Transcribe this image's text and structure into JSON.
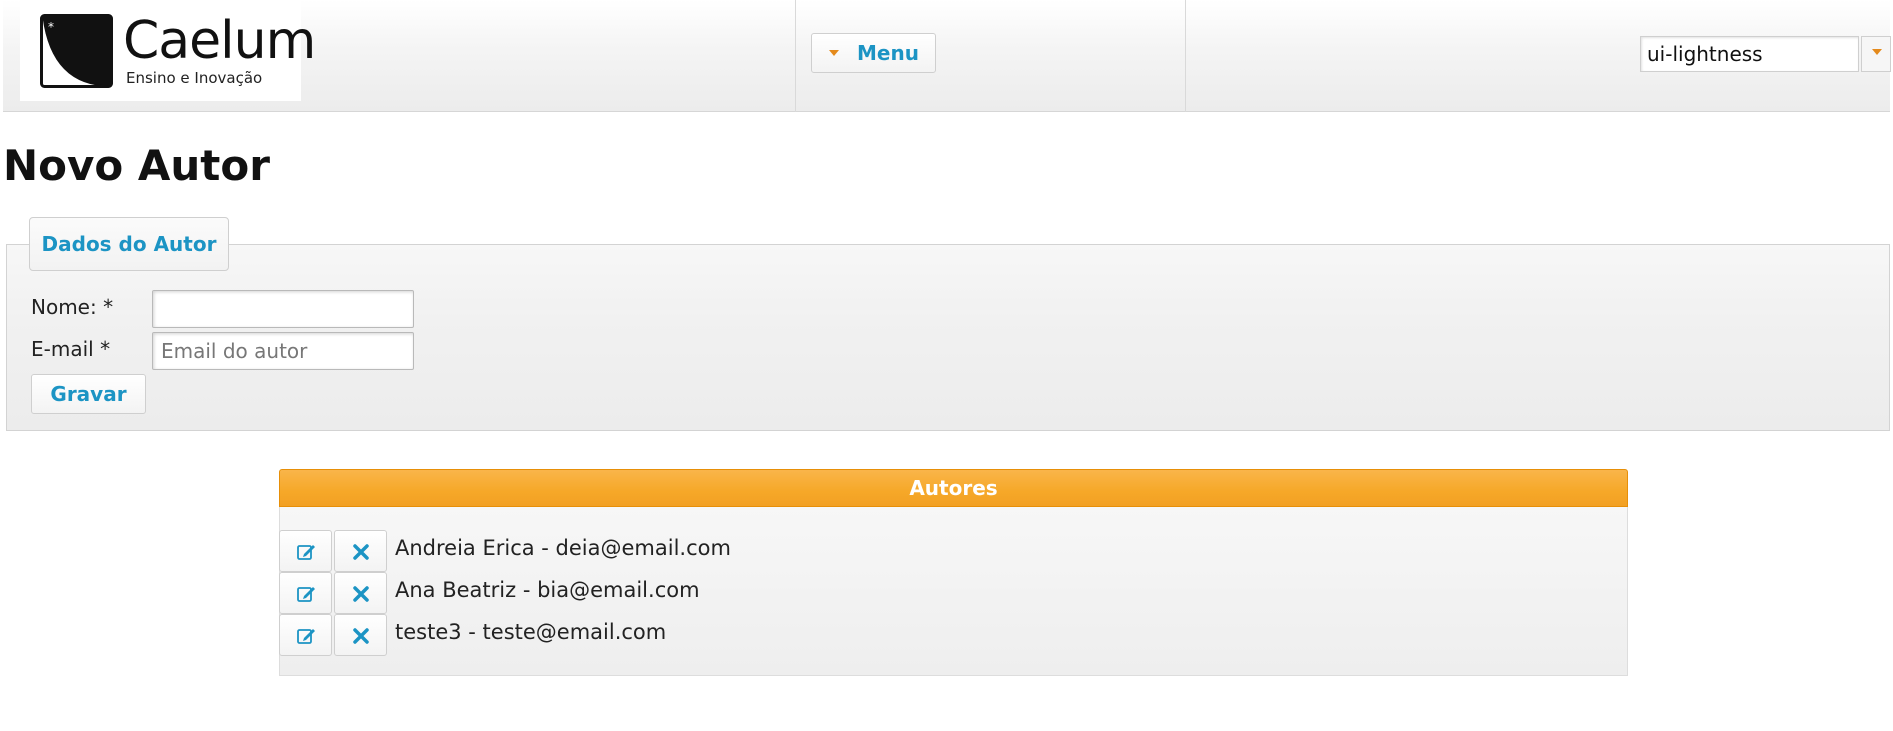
{
  "header": {
    "logo": {
      "brand": "Caelum",
      "tagline": "Ensino e Inovação"
    },
    "menu_label": "Menu",
    "theme_value": "ui-lightness"
  },
  "page": {
    "title": "Novo Autor"
  },
  "form": {
    "legend": "Dados do Autor",
    "name_label": "Nome: *",
    "name_value": "",
    "email_label": "E-mail *",
    "email_placeholder": "Email do autor",
    "save_label": "Gravar"
  },
  "autores": {
    "header": "Autores",
    "rows": [
      {
        "text": "Andreia Erica - deia@email.com"
      },
      {
        "text": "Ana Beatriz - bia@email.com"
      },
      {
        "text": "teste3 - teste@email.com"
      }
    ]
  },
  "icons": {
    "menu_caret": "triangle-down-icon",
    "theme_caret": "triangle-down-icon",
    "edit": "pencil-square-icon",
    "delete": "close-x-icon"
  },
  "colors": {
    "link_blue": "#1c94c4",
    "accent_orange": "#f6a828",
    "caret_orange": "#e48a1c",
    "header_text": "#ffffff"
  }
}
